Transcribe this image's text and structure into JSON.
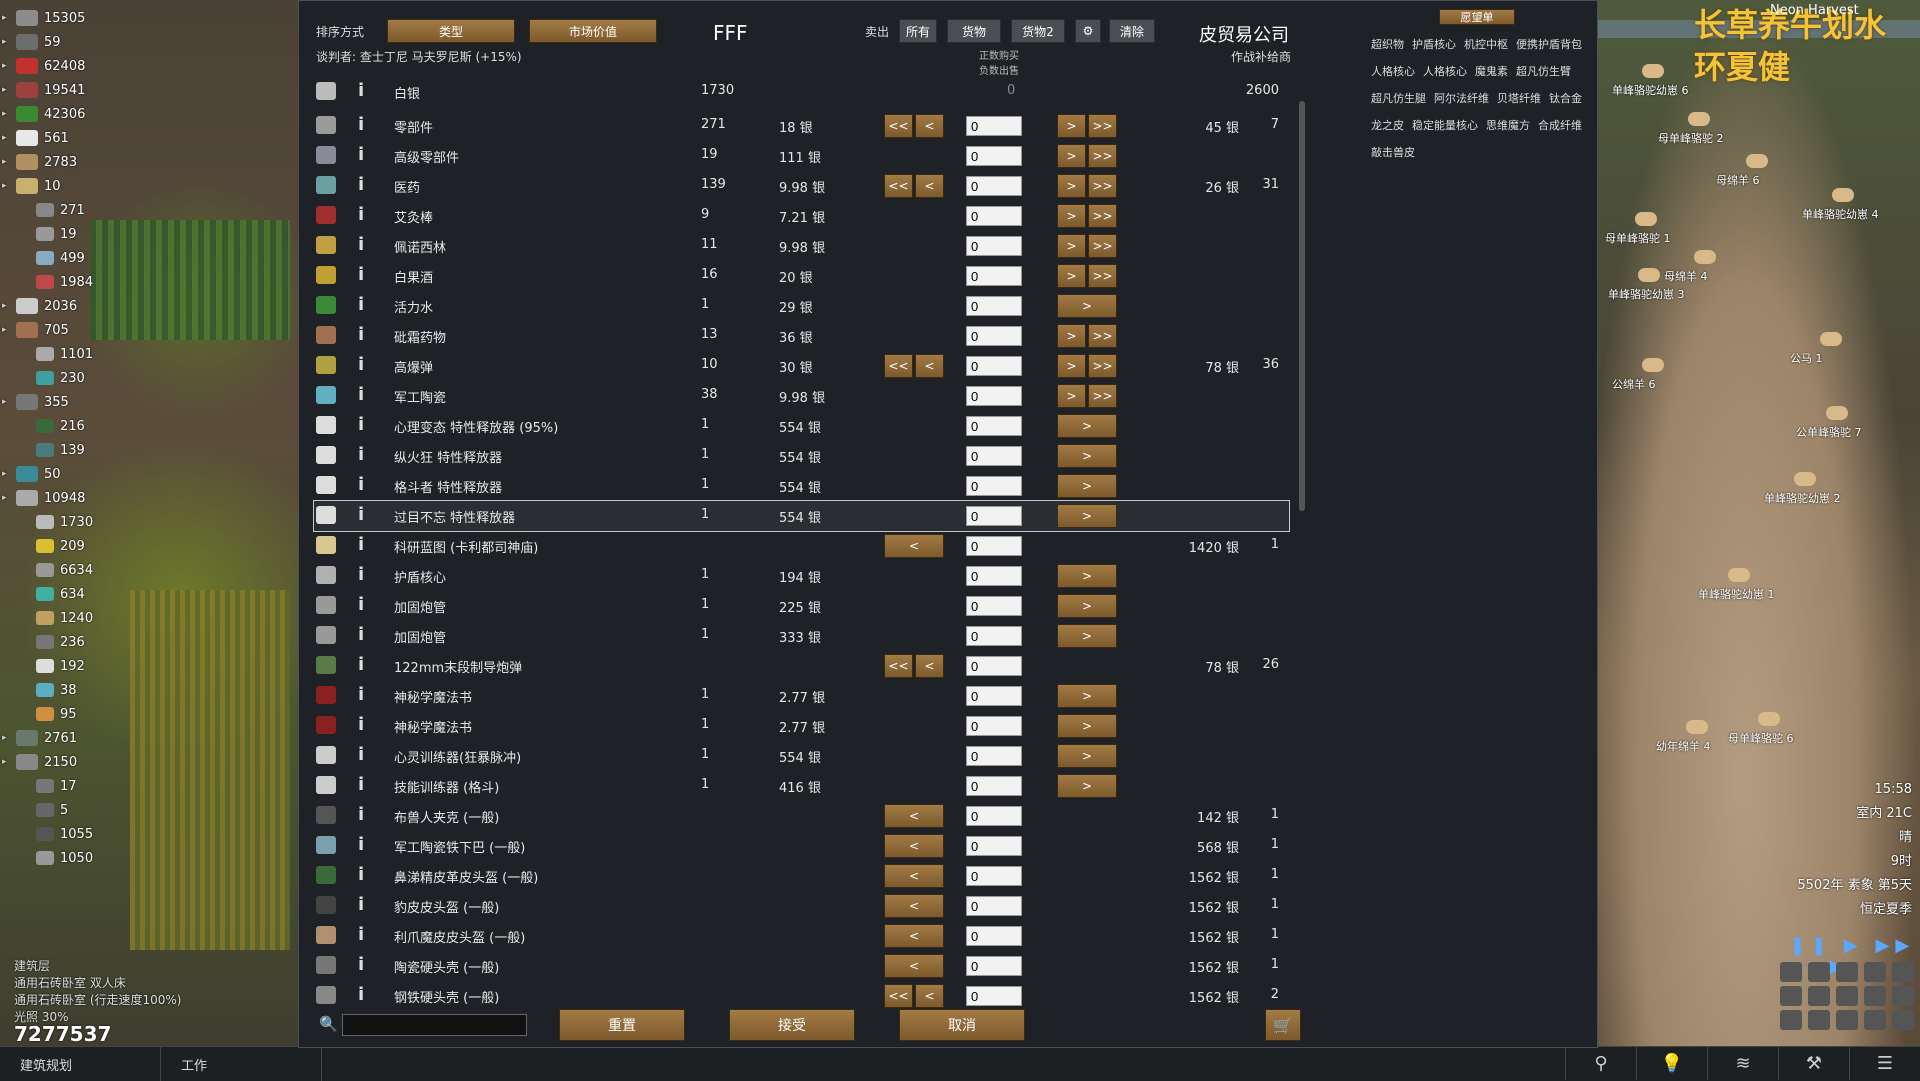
{
  "world": {
    "watermark_line1": "长草养牛划水",
    "watermark_line2": "环夏健",
    "season_name": "Neon Harvest",
    "time": "15:58",
    "indoor_temp": "室内 21C",
    "weather": "晴",
    "hour": "9时",
    "date": "5502年 素象 第5天",
    "season": "恒定夏季",
    "animals": [
      {
        "label": "单峰骆驼幼崽 6"
      },
      {
        "label": "母单峰骆驼 2"
      },
      {
        "label": "母绵羊 6"
      },
      {
        "label": "单峰骆驼幼崽 4"
      },
      {
        "label": "母单峰骆驼 1"
      },
      {
        "label": "母绵羊 4"
      },
      {
        "label": "单峰骆驼幼崽 3"
      },
      {
        "label": "公马 1"
      },
      {
        "label": "公绵羊 6"
      },
      {
        "label": "公单峰骆驼 7"
      },
      {
        "label": "单峰骆驼幼崽 2"
      },
      {
        "label": "单峰骆驼幼崽 1"
      },
      {
        "label": "幼年绵羊 4"
      },
      {
        "label": "母单峰骆驼 6"
      }
    ],
    "notes": [
      "建筑层",
      "通用石砖卧室 双人床",
      "通用石砖卧室 (行走速度100%)",
      "光照 30%"
    ],
    "silver_total": "7277537",
    "bottom_tabs": [
      "建筑规划",
      "工作"
    ]
  },
  "resources": [
    {
      "v": "15305",
      "sub": false,
      "color": "#8c8c8c"
    },
    {
      "v": "59",
      "sub": false,
      "color": "#6d6d6d"
    },
    {
      "v": "62408",
      "sub": false,
      "color": "#c23030"
    },
    {
      "v": "19541",
      "sub": false,
      "color": "#9c4040"
    },
    {
      "v": "42306",
      "sub": false,
      "color": "#3a8a30"
    },
    {
      "v": "561",
      "sub": false,
      "color": "#e8e8e8"
    },
    {
      "v": "2783",
      "sub": false,
      "color": "#b09060"
    },
    {
      "v": "10",
      "sub": false,
      "color": "#c8b070"
    },
    {
      "v": "271",
      "sub": true,
      "color": "#888"
    },
    {
      "v": "19",
      "sub": true,
      "color": "#999"
    },
    {
      "v": "499",
      "sub": true,
      "color": "#8aaac0"
    },
    {
      "v": "1984",
      "sub": true,
      "color": "#c04848"
    },
    {
      "v": "2036",
      "sub": false,
      "color": "#ccc"
    },
    {
      "v": "705",
      "sub": false,
      "color": "#a07050"
    },
    {
      "v": "1101",
      "sub": true,
      "color": "#aaa"
    },
    {
      "v": "230",
      "sub": true,
      "color": "#40a0a0"
    },
    {
      "v": "355",
      "sub": false,
      "color": "#777"
    },
    {
      "v": "216",
      "sub": true,
      "color": "#3a6a3a"
    },
    {
      "v": "139",
      "sub": true,
      "color": "#4a7a7a"
    },
    {
      "v": "50",
      "sub": false,
      "color": "#3a8a9a"
    },
    {
      "v": "10948",
      "sub": false,
      "color": "#aaa"
    },
    {
      "v": "1730",
      "sub": true,
      "color": "#bbb"
    },
    {
      "v": "209",
      "sub": true,
      "color": "#d8c030"
    },
    {
      "v": "6634",
      "sub": true,
      "color": "#999"
    },
    {
      "v": "634",
      "sub": true,
      "color": "#40b0a0"
    },
    {
      "v": "1240",
      "sub": true,
      "color": "#c0a060"
    },
    {
      "v": "236",
      "sub": true,
      "color": "#777"
    },
    {
      "v": "192",
      "sub": true,
      "color": "#ddd"
    },
    {
      "v": "38",
      "sub": true,
      "color": "#5ab0c0"
    },
    {
      "v": "95",
      "sub": true,
      "color": "#d09040"
    },
    {
      "v": "2761",
      "sub": false,
      "color": "#6a7a6a"
    },
    {
      "v": "2150",
      "sub": false,
      "color": "#888"
    },
    {
      "v": "17",
      "sub": true,
      "color": "#777"
    },
    {
      "v": "5",
      "sub": true,
      "color": "#666"
    },
    {
      "v": "1055",
      "sub": true,
      "color": "#555"
    },
    {
      "v": "1050",
      "sub": true,
      "color": "#999"
    }
  ],
  "trade": {
    "sort_label": "排序方式",
    "sort_btn1": "类型",
    "sort_btn2": "市场价值",
    "colony_name": "FFF",
    "sell_label": "卖出",
    "filter_all": "所有",
    "filter_goods": "货物",
    "filter_goods2": "货物2",
    "clear_btn": "清除",
    "trader_name": "皮贸易公司",
    "trader_type": "作战补给商",
    "negotiator": "谈判者: 查士丁尼 马夫罗尼斯 (+15%)",
    "hint_line1": "正数购买",
    "hint_line2": "负数出售",
    "wishlist_btn": "愿望单",
    "wishlist": [
      "超织物",
      "护盾核心",
      "机控中枢",
      "便携护盾背包",
      "人格核心",
      "人格核心",
      "魔鬼素",
      "超凡仿生臂",
      "超凡仿生腿",
      "阿尔法纤维",
      "贝塔纤维",
      "钛合金",
      "龙之皮",
      "稳定能量核心",
      "思维魔方",
      "合成纤维",
      "敲击兽皮"
    ],
    "silver": {
      "name": "白银",
      "count": "1730",
      "mid": "0",
      "trader": "2600"
    },
    "reset_btn": "重置",
    "accept_btn": "接受",
    "cancel_btn": "取消",
    "search_placeholder": "",
    "rows": [
      {
        "name": "零部件",
        "count": "271",
        "price": "18 银",
        "ll": true,
        "l": true,
        "r": true,
        "rr": true,
        "qty": "0",
        "tprice": "45 银",
        "tcnt": "7",
        "color": "#9a9a9a"
      },
      {
        "name": "高级零部件",
        "count": "19",
        "price": "111 银",
        "ll": false,
        "l": false,
        "r": true,
        "rr": true,
        "qty": "0",
        "tprice": "",
        "tcnt": "",
        "color": "#8a8a9a"
      },
      {
        "name": "医药",
        "count": "139",
        "price": "9.98 银",
        "ll": true,
        "l": true,
        "r": true,
        "rr": true,
        "qty": "0",
        "tprice": "26 银",
        "tcnt": "31",
        "color": "#6aa0a0"
      },
      {
        "name": "艾灸棒",
        "count": "9",
        "price": "7.21 银",
        "ll": false,
        "l": false,
        "r": true,
        "rr": true,
        "qty": "0",
        "tprice": "",
        "tcnt": "",
        "color": "#a03030"
      },
      {
        "name": "佩诺西林",
        "count": "11",
        "price": "9.98 银",
        "ll": false,
        "l": false,
        "r": true,
        "rr": true,
        "qty": "0",
        "tprice": "",
        "tcnt": "",
        "color": "#c0a040"
      },
      {
        "name": "白果酒",
        "count": "16",
        "price": "20 银",
        "ll": false,
        "l": false,
        "r": true,
        "rr": true,
        "qty": "0",
        "tprice": "",
        "tcnt": "",
        "color": "#c0a030"
      },
      {
        "name": "活力水",
        "count": "1",
        "price": "29 银",
        "ll": false,
        "l": false,
        "r": true,
        "rr": false,
        "qty": "0",
        "tprice": "",
        "tcnt": "",
        "color": "#3a8a3a"
      },
      {
        "name": "砒霜药物",
        "count": "13",
        "price": "36 银",
        "ll": false,
        "l": false,
        "r": true,
        "rr": true,
        "qty": "0",
        "tprice": "",
        "tcnt": "",
        "color": "#a07050"
      },
      {
        "name": "高爆弹",
        "count": "10",
        "price": "30 银",
        "ll": true,
        "l": true,
        "r": true,
        "rr": true,
        "qty": "0",
        "tprice": "78 银",
        "tcnt": "36",
        "color": "#b0a040"
      },
      {
        "name": "军工陶瓷",
        "count": "38",
        "price": "9.98 银",
        "ll": false,
        "l": false,
        "r": true,
        "rr": true,
        "qty": "0",
        "tprice": "",
        "tcnt": "",
        "color": "#60b0c0"
      },
      {
        "name": "心理变态 特性释放器 (95%)",
        "count": "1",
        "price": "554 银",
        "ll": false,
        "l": false,
        "r": true,
        "rr": false,
        "qty": "0",
        "tprice": "",
        "tcnt": "",
        "color": "#ddd"
      },
      {
        "name": "纵火狂 特性释放器",
        "count": "1",
        "price": "554 银",
        "ll": false,
        "l": false,
        "r": true,
        "rr": false,
        "qty": "0",
        "tprice": "",
        "tcnt": "",
        "color": "#ddd"
      },
      {
        "name": "格斗者 特性释放器",
        "count": "1",
        "price": "554 银",
        "ll": false,
        "l": false,
        "r": true,
        "rr": false,
        "qty": "0",
        "tprice": "",
        "tcnt": "",
        "color": "#ddd"
      },
      {
        "name": "过目不忘 特性释放器",
        "count": "1",
        "price": "554 银",
        "ll": false,
        "l": false,
        "r": true,
        "rr": false,
        "qty": "0",
        "tprice": "",
        "tcnt": "",
        "color": "#ddd",
        "highlight": true
      },
      {
        "name": "科研蓝图 (卡利都司神庙)",
        "count": "",
        "price": "",
        "ll": false,
        "l": true,
        "r": false,
        "rr": false,
        "qty": "0",
        "tprice": "1420 银",
        "tcnt": "1",
        "color": "#d8c890"
      },
      {
        "name": "护盾核心",
        "count": "1",
        "price": "194 银",
        "ll": false,
        "l": false,
        "r": true,
        "rr": false,
        "qty": "0",
        "tprice": "",
        "tcnt": "",
        "color": "#b0b0b0"
      },
      {
        "name": "加固炮管",
        "count": "1",
        "price": "225 银",
        "ll": false,
        "l": false,
        "r": true,
        "rr": false,
        "qty": "0",
        "tprice": "",
        "tcnt": "",
        "color": "#999"
      },
      {
        "name": "加固炮管",
        "count": "1",
        "price": "333 银",
        "ll": false,
        "l": false,
        "r": true,
        "rr": false,
        "qty": "0",
        "tprice": "",
        "tcnt": "",
        "color": "#999"
      },
      {
        "name": "122mm末段制导炮弹",
        "count": "",
        "price": "",
        "ll": true,
        "l": true,
        "r": false,
        "rr": false,
        "qty": "0",
        "tprice": "78 银",
        "tcnt": "26",
        "color": "#5a7a4a"
      },
      {
        "name": "神秘学魔法书",
        "count": "1",
        "price": "2.77 银",
        "ll": false,
        "l": false,
        "r": true,
        "rr": false,
        "qty": "0",
        "tprice": "",
        "tcnt": "",
        "color": "#8a2020"
      },
      {
        "name": "神秘学魔法书",
        "count": "1",
        "price": "2.77 银",
        "ll": false,
        "l": false,
        "r": true,
        "rr": false,
        "qty": "0",
        "tprice": "",
        "tcnt": "",
        "color": "#8a2020"
      },
      {
        "name": "心灵训练器(狂暴脉冲)",
        "count": "1",
        "price": "554 银",
        "ll": false,
        "l": false,
        "r": true,
        "rr": false,
        "qty": "0",
        "tprice": "",
        "tcnt": "",
        "color": "#ccc"
      },
      {
        "name": "技能训练器 (格斗)",
        "count": "1",
        "price": "416 银",
        "ll": false,
        "l": false,
        "r": true,
        "rr": false,
        "qty": "0",
        "tprice": "",
        "tcnt": "",
        "color": "#ccc"
      },
      {
        "name": "布兽人夹克 (一般)",
        "count": "",
        "price": "",
        "ll": false,
        "l": true,
        "r": false,
        "rr": false,
        "qty": "0",
        "tprice": "142 银",
        "tcnt": "1",
        "color": "#555"
      },
      {
        "name": "军工陶瓷铁下巴 (一般)",
        "count": "",
        "price": "",
        "ll": false,
        "l": true,
        "r": false,
        "rr": false,
        "qty": "0",
        "tprice": "568 银",
        "tcnt": "1",
        "color": "#7aa0b0"
      },
      {
        "name": "鼻涕精皮革皮头盔 (一般)",
        "count": "",
        "price": "",
        "ll": false,
        "l": true,
        "r": false,
        "rr": false,
        "qty": "0",
        "tprice": "1562 银",
        "tcnt": "1",
        "color": "#3a6a3a"
      },
      {
        "name": "豹皮皮头盔 (一般)",
        "count": "",
        "price": "",
        "ll": false,
        "l": true,
        "r": false,
        "rr": false,
        "qty": "0",
        "tprice": "1562 银",
        "tcnt": "1",
        "color": "#444"
      },
      {
        "name": "利爪魔皮皮头盔 (一般)",
        "count": "",
        "price": "",
        "ll": false,
        "l": true,
        "r": false,
        "rr": false,
        "qty": "0",
        "tprice": "1562 银",
        "tcnt": "1",
        "color": "#b09070"
      },
      {
        "name": "陶瓷硬头壳 (一般)",
        "count": "",
        "price": "",
        "ll": false,
        "l": true,
        "r": false,
        "rr": false,
        "qty": "0",
        "tprice": "1562 银",
        "tcnt": "1",
        "color": "#777"
      },
      {
        "name": "钢铁硬头壳 (一般)",
        "count": "",
        "price": "",
        "ll": true,
        "l": true,
        "r": false,
        "rr": false,
        "qty": "0",
        "tprice": "1562 银",
        "tcnt": "2",
        "color": "#888"
      }
    ]
  },
  "colors": {
    "button_brown": "#a27a45",
    "panel": "#1e2226",
    "watermark": "#f3c33a"
  }
}
